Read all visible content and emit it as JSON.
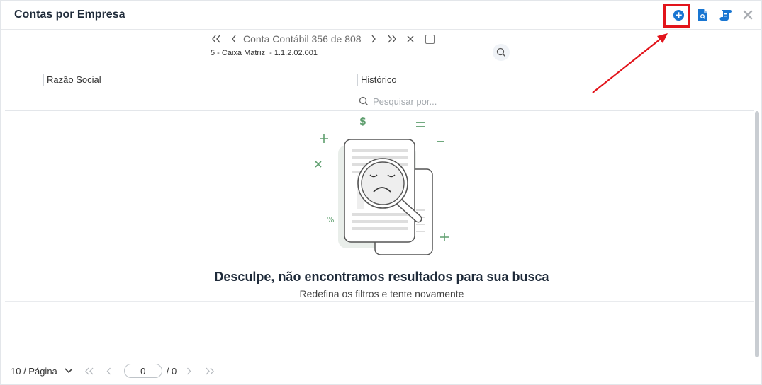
{
  "window": {
    "title": "Contas por Empresa"
  },
  "navigator": {
    "label": "Conta Contábil 356 de 808",
    "record": "5 - Caixa Matriz  - 1.1.2.02.001"
  },
  "columns": {
    "razao_social": "Razão Social",
    "historico": "Histórico",
    "search_placeholder": "Pesquisar por..."
  },
  "empty_state": {
    "title": "Desculpe, não encontramos resultados para sua busca",
    "subtitle": "Redefina os filtros e tente novamente"
  },
  "pagination": {
    "page_size": "10 / Página",
    "current_page": "0",
    "total_pages": "/ 0"
  },
  "colors": {
    "accent": "#1976d2",
    "highlight": "#e2141b",
    "illustration_green": "#5e9e6e"
  },
  "icons": [
    "add-icon",
    "document-search-icon",
    "scroll-icon",
    "close-icon",
    "search-icon",
    "chevron-down-icon"
  ]
}
